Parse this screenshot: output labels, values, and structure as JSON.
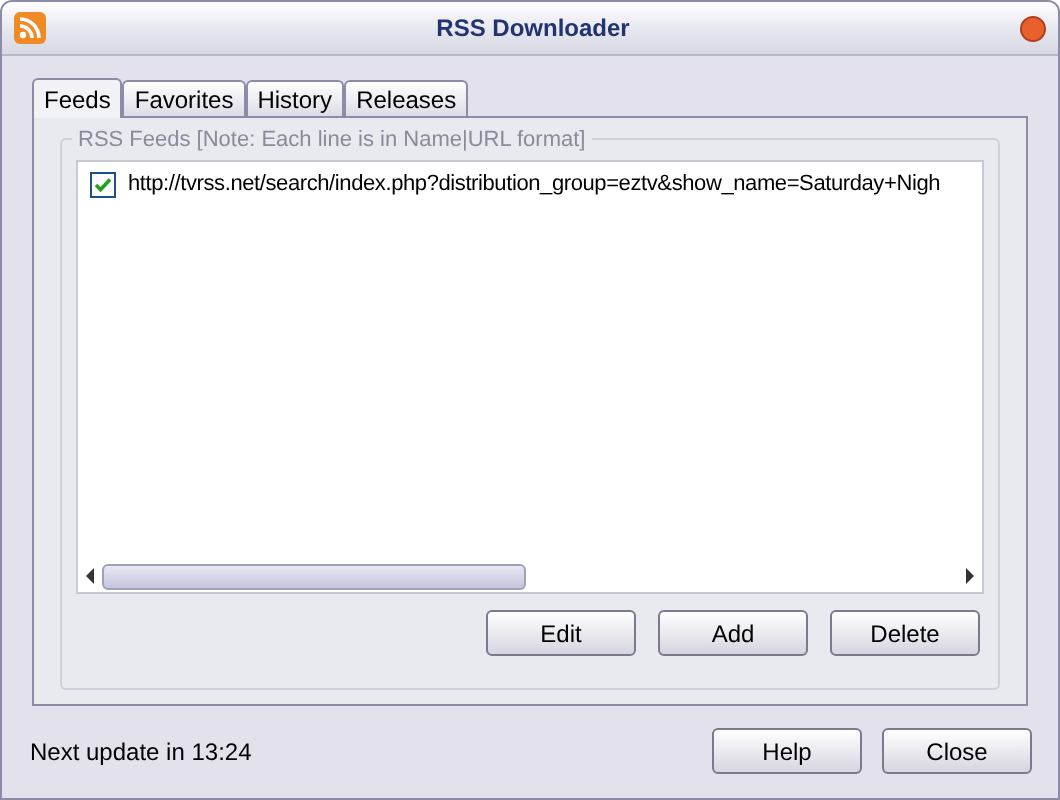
{
  "window": {
    "title": "RSS Downloader"
  },
  "tabs": [
    {
      "label": "Feeds",
      "selected": true
    },
    {
      "label": "Favorites",
      "selected": false
    },
    {
      "label": "History",
      "selected": false
    },
    {
      "label": "Releases",
      "selected": false
    }
  ],
  "group": {
    "legend": "RSS Feeds [Note: Each line is in Name|URL format]"
  },
  "feeds": [
    {
      "url": "http://tvrss.net/search/index.php?distribution_group=eztv&show_name=Saturday+Nigh",
      "checked": true
    }
  ],
  "feed_buttons": [
    "Edit",
    "Add",
    "Delete"
  ],
  "status": "Next update in 13:24",
  "buttons": [
    "Help",
    "Close"
  ]
}
